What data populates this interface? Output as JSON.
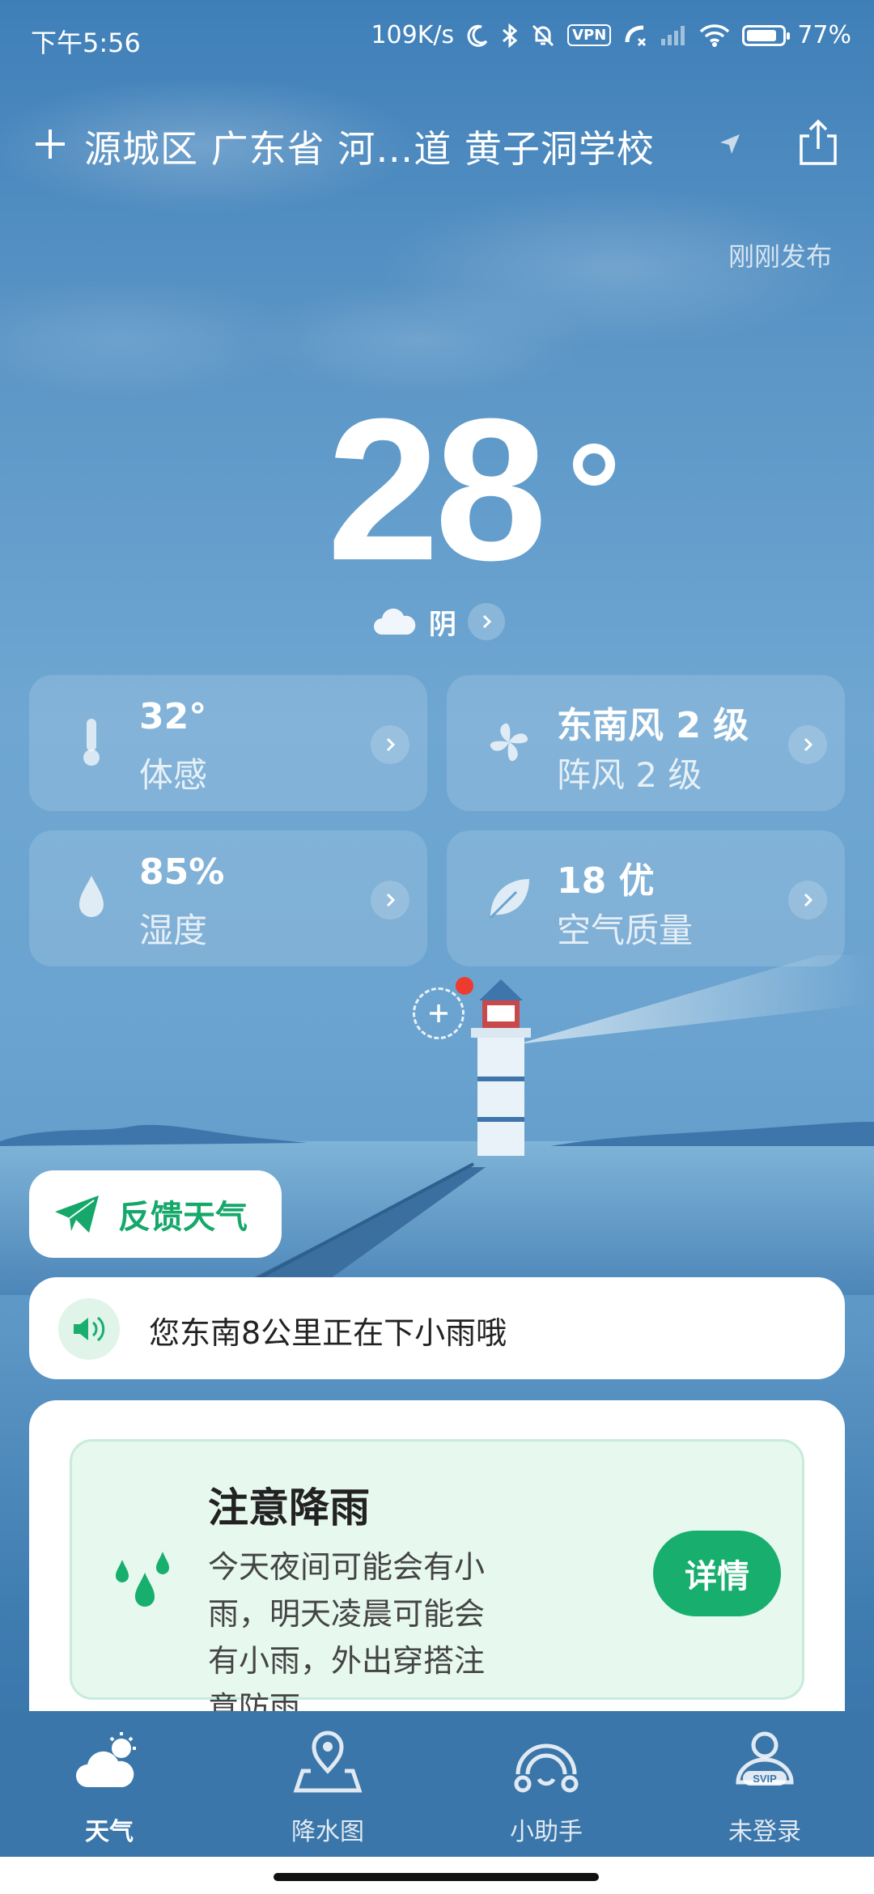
{
  "status_bar": {
    "time": "下午5:56",
    "net_speed": "109K/s",
    "vpn": "VPN",
    "battery_text": "77%",
    "battery_level": 0.77
  },
  "header": {
    "location": "源城区 广东省 河…道 黄子洞学校",
    "published": "刚刚发布"
  },
  "current": {
    "temperature": "28",
    "condition": "阴"
  },
  "cards": [
    {
      "value": "32°",
      "label": "体感",
      "icon": "thermometer-icon"
    },
    {
      "value": "东南风 2 级",
      "label": "阵风 2 级",
      "icon": "fan-icon"
    },
    {
      "value": "85%",
      "label": "湿度",
      "icon": "droplet-icon"
    },
    {
      "value": "18 优",
      "label": "空气质量",
      "icon": "leaf-icon"
    }
  ],
  "feedback": {
    "label": "反馈天气"
  },
  "notice": {
    "text": "您东南8公里正在下小雨哦"
  },
  "alert": {
    "title": "注意降雨",
    "description": "今天夜间可能会有小雨，明天凌晨可能会有小雨，外出穿搭注意防雨",
    "button": "详情"
  },
  "nav": [
    {
      "label": "天气",
      "icon": "weather-icon",
      "active": true
    },
    {
      "label": "降水图",
      "icon": "map-pin-icon",
      "active": false
    },
    {
      "label": "小助手",
      "icon": "assistant-icon",
      "active": false
    },
    {
      "label": "未登录",
      "icon": "user-svip-icon",
      "active": false
    }
  ],
  "colors": {
    "accent": "#17ae6e",
    "alert_bg": "#e7f8ef",
    "sky": "#6aa3cf",
    "nav_bg": "#3a76a9"
  }
}
